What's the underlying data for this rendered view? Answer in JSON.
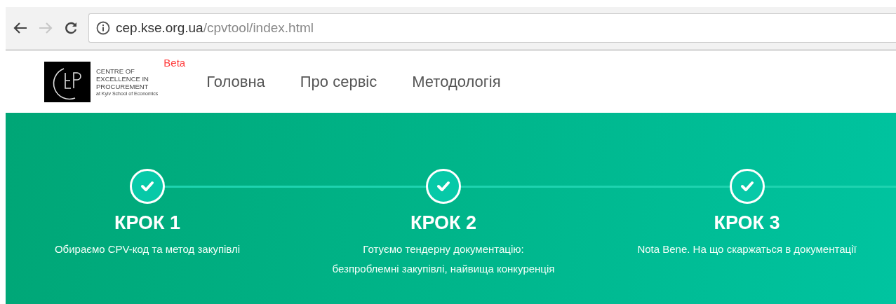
{
  "browser": {
    "nav_buttons": [
      {
        "kind": "back",
        "disabled": false
      },
      {
        "kind": "forward",
        "disabled": true
      },
      {
        "kind": "reload",
        "disabled": false
      }
    ],
    "url_host": "cep.kse.org.ua",
    "url_path": "/cpvtool/index.html"
  },
  "header": {
    "logo_lines": [
      "CENTRE OF",
      "EXCELLENCE IN",
      "PROCUREMENT"
    ],
    "logo_subtitle": "at Kyiv School of Economics",
    "badge": "Beta",
    "nav": [
      {
        "label": "Головна"
      },
      {
        "label": "Про сервіс"
      },
      {
        "label": "Методологія"
      }
    ]
  },
  "steps": [
    {
      "title": "КРОК 1",
      "description": "Обираємо CPV-код та метод закупівлі",
      "done": true
    },
    {
      "title": "КРОК 2",
      "description": "Готуємо тендерну документацію:\nбезпроблемні закупівлі, найвища конкуренція",
      "done": true
    },
    {
      "title": "КРОК 3",
      "description": "Nota Bene. На що скаржаться в документації",
      "done": true
    }
  ]
}
